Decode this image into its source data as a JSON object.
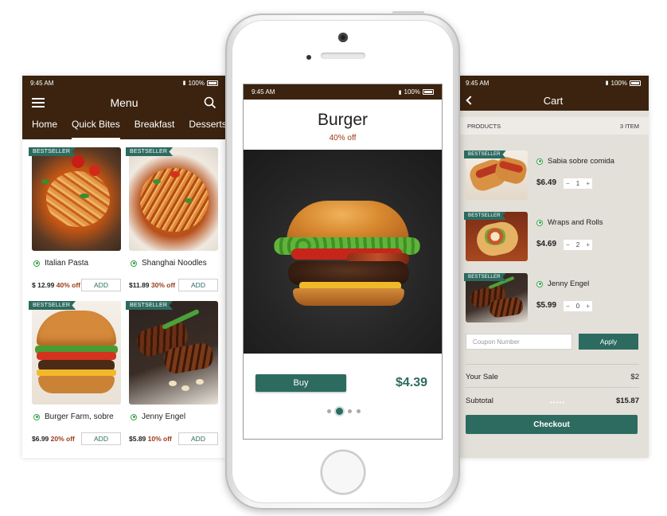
{
  "colors": {
    "brand_brown": "#3b230f",
    "accent_teal": "#2d6b60",
    "discount_red": "#9a3a14",
    "veg_green": "#3aa44a",
    "cart_bg": "#e3dfd9"
  },
  "left": {
    "status": {
      "signal": "•••••",
      "time": "9:45 AM",
      "battery": "100%"
    },
    "title": "Menu",
    "icons": {
      "menu": "hamburger-icon",
      "search": "search-icon"
    },
    "tabs": [
      {
        "label": "Home"
      },
      {
        "label": "Quick Bites"
      },
      {
        "label": "Breakfast"
      },
      {
        "label": "Desserts"
      }
    ],
    "active_tab": "Quick Bites",
    "badge": "BESTSELLER",
    "add_label": "ADD",
    "items": [
      {
        "name": "Italian Pasta",
        "price": "$ 12.99",
        "discount": "40% off"
      },
      {
        "name": "Shanghai Noodles",
        "price": "$11.89",
        "discount": "30% off"
      },
      {
        "name": "Burger Farm, sobre",
        "price": "$6.99",
        "discount": "20% off"
      },
      {
        "name": "Jenny Engel",
        "price": "$5.89",
        "discount": "10% off"
      }
    ]
  },
  "center": {
    "status": {
      "signal": "•••••",
      "time": "9:45 AM",
      "battery": "100%"
    },
    "product_title": "Burger",
    "product_discount": "40% off",
    "buy_label": "Buy",
    "price": "$4.39",
    "carousel": {
      "count": 4,
      "active_index": 1
    }
  },
  "right": {
    "status": {
      "signal": "•••••",
      "time": "9:45 AM",
      "battery": "100%"
    },
    "title": "Cart",
    "products_label": "PRODUCTS",
    "item_count": "3 ITEM",
    "badge": "BESTSELLER",
    "items": [
      {
        "name": "Sabia sobre comida",
        "price": "$6.49",
        "qty": "1"
      },
      {
        "name": "Wraps and Rolls",
        "price": "$4.69",
        "qty": "2"
      },
      {
        "name": "Jenny Engel",
        "price": "$5.99",
        "qty": "0"
      }
    ],
    "stepper_minus": "−",
    "stepper_plus": "+",
    "coupon_placeholder": "Coupon Number",
    "apply_label": "Apply",
    "your_sale_label": "Your Sale",
    "your_sale_value": "$2",
    "subtotal_label": "Subtotal",
    "subtotal_value": "$15.87",
    "checkout_label": "Checkout"
  }
}
